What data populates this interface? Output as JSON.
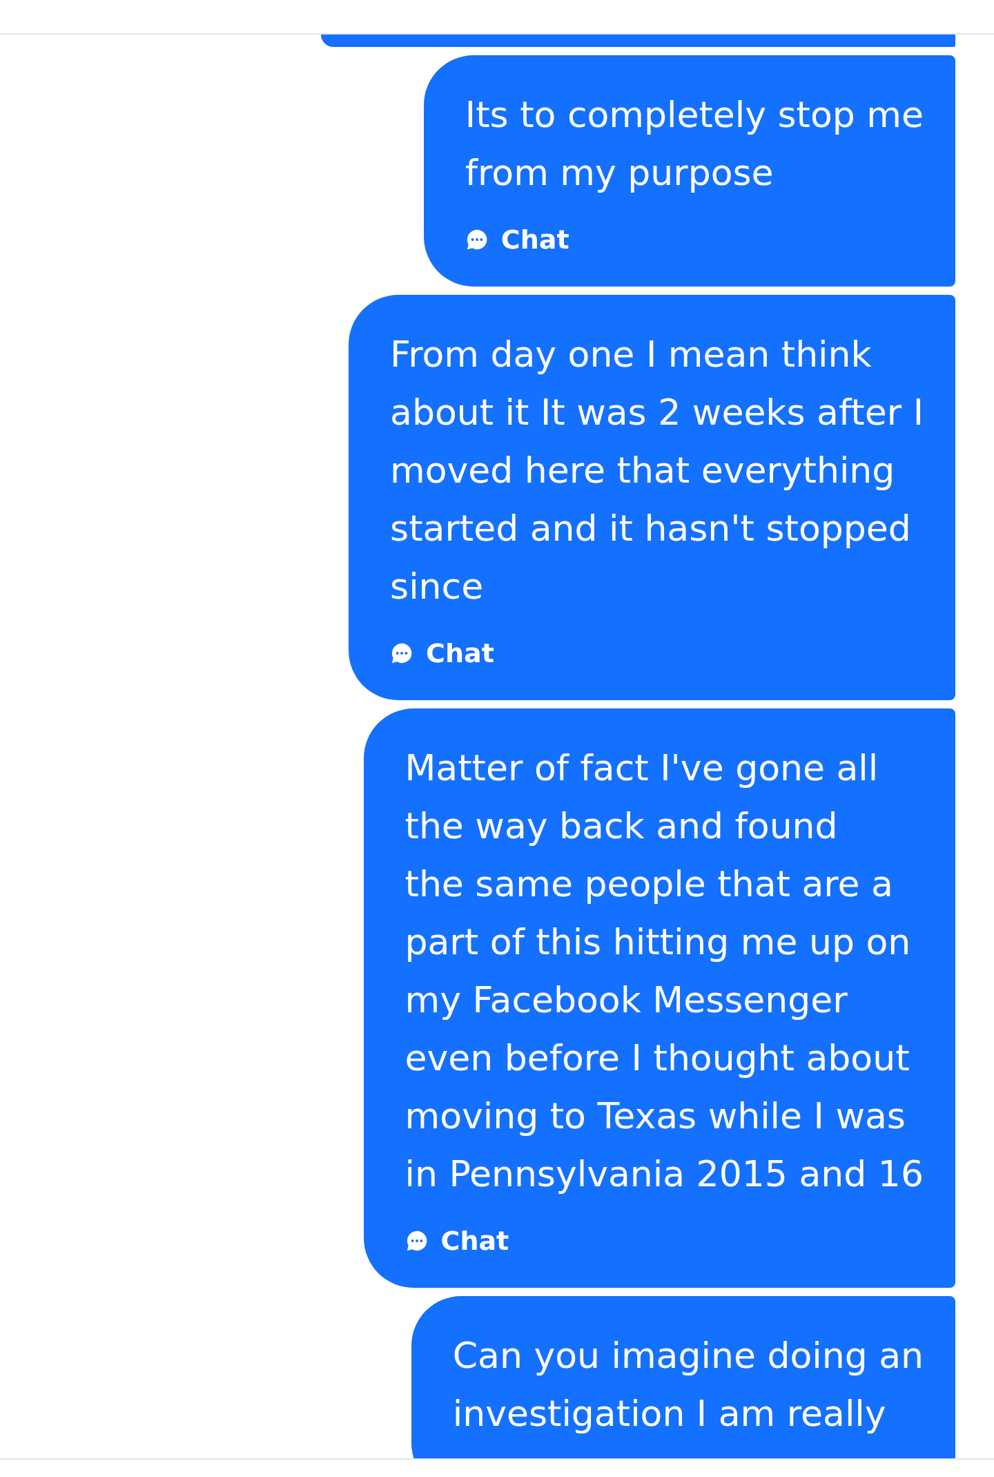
{
  "messages": [
    {
      "kind": "fragment"
    },
    {
      "kind": "message",
      "lines": [
        "Its to completely stop me",
        "from my purpose"
      ],
      "label": "Chat"
    },
    {
      "kind": "message",
      "lines": [
        "From day one I mean think",
        "about it It was 2 weeks after I",
        "moved here that everything",
        "started and it hasn't stopped",
        "since"
      ],
      "label": "Chat"
    },
    {
      "kind": "message",
      "lines": [
        "Matter of fact I've gone all",
        "the way back and found",
        "the same people that are a",
        "part of this hitting me up on",
        "my Facebook Messenger",
        "even before I thought about",
        "moving to Texas while I was",
        "in Pennsylvania 2015 and 16"
      ],
      "label": "Chat"
    },
    {
      "kind": "message",
      "lines": [
        "Can you imagine doing an",
        "investigation I am really"
      ]
    }
  ]
}
